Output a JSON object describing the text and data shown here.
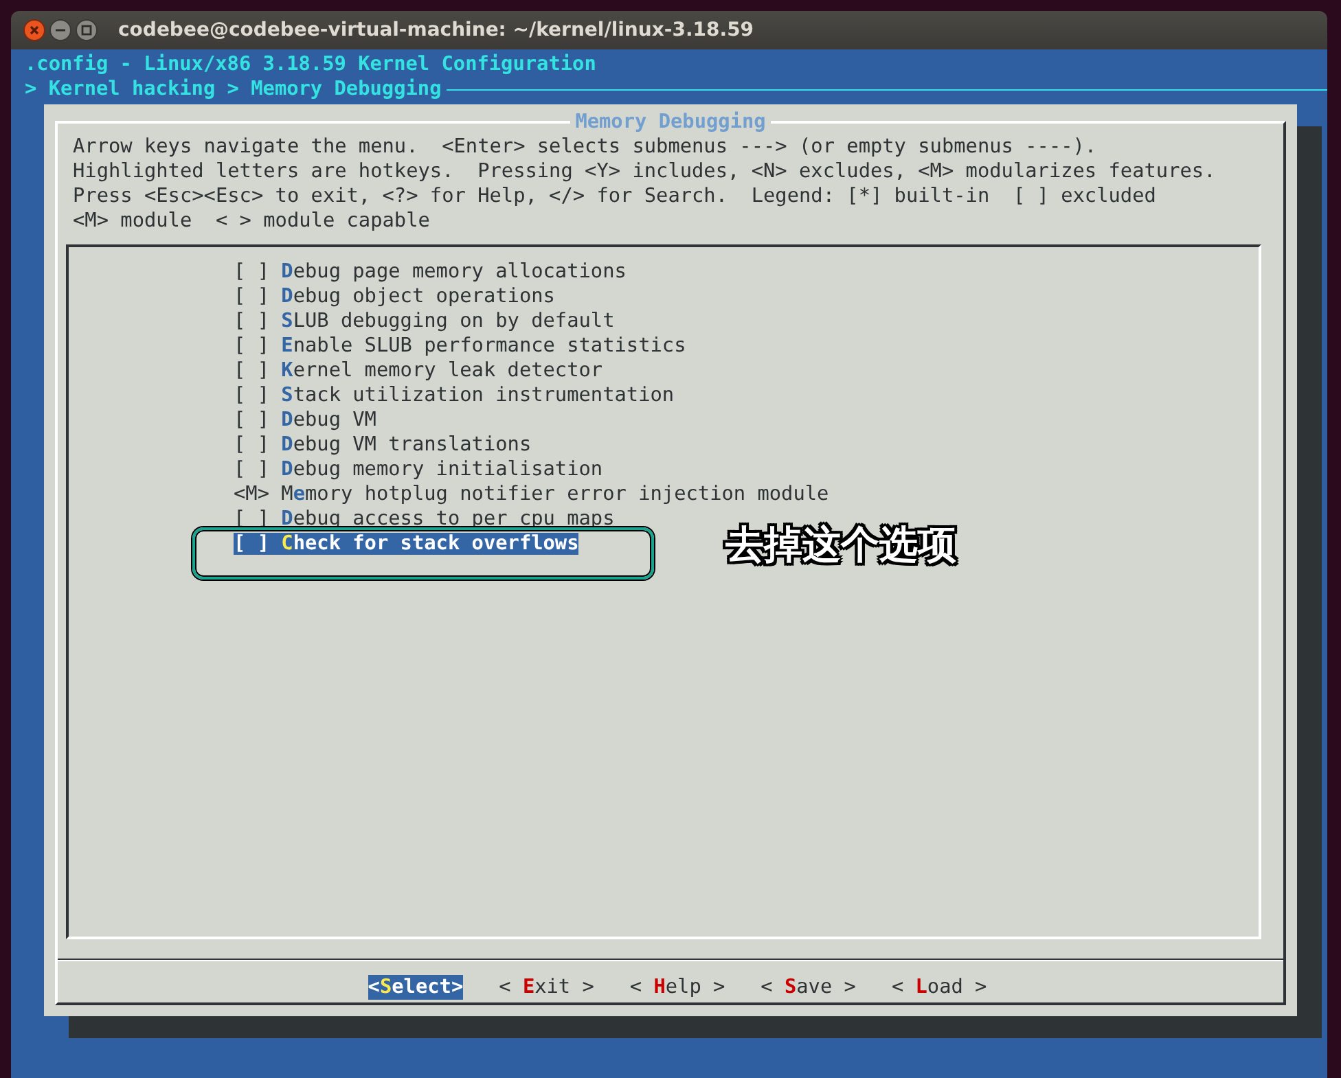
{
  "window": {
    "title": "codebee@codebee-virtual-machine: ~/kernel/linux-3.18.59"
  },
  "header": {
    "title": ".config - Linux/x86 3.18.59 Kernel Configuration",
    "breadcrumb": "> Kernel hacking > Memory Debugging"
  },
  "dialog": {
    "title": "Memory Debugging",
    "help": [
      "Arrow keys navigate the menu.  <Enter> selects submenus ---> (or empty submenus ----).",
      "Highlighted letters are hotkeys.  Pressing <Y> includes, <N> excludes, <M> modularizes features.",
      "Press <Esc><Esc> to exit, <?> for Help, </> for Search.  Legend: [*] built-in  [ ] excluded",
      "<M> module  < > module capable"
    ],
    "items": [
      {
        "prefix": "[ ]",
        "hotkey": "D",
        "rest": "ebug page memory allocations",
        "selected": false
      },
      {
        "prefix": "[ ]",
        "hotkey": "D",
        "rest": "ebug object operations",
        "selected": false
      },
      {
        "prefix": "[ ]",
        "hotkey": "S",
        "rest": "LUB debugging on by default",
        "selected": false
      },
      {
        "prefix": "[ ]",
        "hotkey": "E",
        "rest": "nable SLUB performance statistics",
        "selected": false
      },
      {
        "prefix": "[ ]",
        "hotkey": "K",
        "rest": "ernel memory leak detector",
        "selected": false
      },
      {
        "prefix": "[ ]",
        "hotkey": "S",
        "rest": "tack utilization instrumentation",
        "selected": false
      },
      {
        "prefix": "[ ]",
        "hotkey": "D",
        "rest": "ebug VM",
        "selected": false
      },
      {
        "prefix": "[ ]",
        "hotkey": "D",
        "rest": "ebug VM translations",
        "selected": false
      },
      {
        "prefix": "[ ]",
        "hotkey": "D",
        "rest": "ebug memory initialisation",
        "selected": false
      },
      {
        "prefix": "<M>",
        "lead": "M",
        "hotkey": "e",
        "rest": "mory hotplug notifier error injection module",
        "selected": false
      },
      {
        "prefix": "[ ]",
        "hotkey": "D",
        "rest": "ebug access to per cpu maps",
        "selected": false
      },
      {
        "prefix": "[ ]",
        "hotkey": "C",
        "rest": "heck for stack overflows",
        "selected": true
      }
    ],
    "annotation": {
      "text": "去掉这个选项"
    },
    "buttons": [
      {
        "open": "<",
        "hotkey": "S",
        "rest": "elect",
        "close": ">",
        "selected": true
      },
      {
        "open": "<",
        "hotkey": "E",
        "rest": "xit",
        "close": ">",
        "selected": false
      },
      {
        "open": "<",
        "hotkey": "H",
        "rest": "elp",
        "close": ">",
        "selected": false
      },
      {
        "open": "<",
        "hotkey": "S",
        "rest": "ave",
        "close": ">",
        "selected": false
      },
      {
        "open": "<",
        "hotkey": "L",
        "rest": "oad",
        "close": ">",
        "selected": false
      }
    ]
  }
}
